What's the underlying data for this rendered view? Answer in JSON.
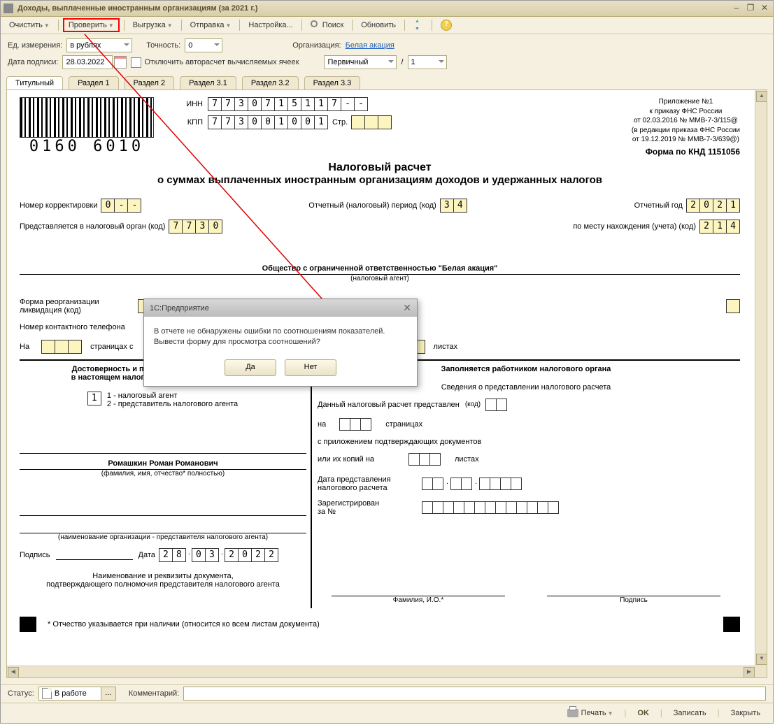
{
  "window": {
    "title": "Доходы, выплаченные иностранным организациям (за 2021 г.)"
  },
  "toolbar": {
    "clear": "Очистить",
    "check": "Проверить",
    "export": "Выгрузка",
    "send": "Отправка",
    "settings": "Настройка...",
    "search": "Поиск",
    "refresh": "Обновить"
  },
  "params": {
    "unit_label": "Ед. измерения:",
    "unit_value": "в рублях",
    "precision_label": "Точность:",
    "precision_value": "0",
    "org_label": "Организация:",
    "org_value": "Белая акация",
    "date_label": "Дата подписи:",
    "date_value": "28.03.2022",
    "autocount_label": "Отключить авторасчет вычисляемых ячеек",
    "primary_value": "Первичный",
    "slash": "/",
    "num": "1"
  },
  "tabs": [
    "Титульный",
    "Раздел 1",
    "Раздел 2",
    "Раздел 3.1",
    "Раздел 3.2",
    "Раздел 3.3"
  ],
  "form": {
    "barcode_num": "0160 6010",
    "inn_label": "ИНН",
    "inn": [
      "7",
      "7",
      "3",
      "0",
      "7",
      "1",
      "5",
      "1",
      "1",
      "7",
      "-",
      "-"
    ],
    "kpp_label": "КПП",
    "kpp": [
      "7",
      "7",
      "3",
      "0",
      "0",
      "1",
      "0",
      "0",
      "1"
    ],
    "page_label": "Стр.",
    "page": [
      "",
      "",
      ""
    ],
    "annex": [
      "Приложение №1",
      "к приказу ФНС России",
      "от 02.03.2016 № ММВ-7-3/115@",
      "(в редакции приказа ФНС России",
      "от 19.12.2019 № ММВ-7-3/639@)"
    ],
    "knd": "Форма по КНД 1151056",
    "title1": "Налоговый расчет",
    "title2": "о суммах выплаченных иностранным организациям доходов и удержанных налогов",
    "corr_label": "Номер корректировки",
    "corr": [
      "0",
      "-",
      "-"
    ],
    "period_label": "Отчетный (налоговый) период (код)",
    "period": [
      "3",
      "4"
    ],
    "year_label": "Отчетный год",
    "year": [
      "2",
      "0",
      "2",
      "1"
    ],
    "tax_org_label": "Представляется в налоговый орган (код)",
    "tax_org": [
      "7",
      "7",
      "3",
      "0"
    ],
    "place_label": "по месту нахождения (учета) (код)",
    "place": [
      "2",
      "1",
      "4"
    ],
    "org_full": "Общество с ограниченной ответственностью \"Белая акация\"",
    "agent_note": "(налоговый агент)",
    "reorg_label": "Форма реорганизации\nликвидация (код)",
    "phone_label": "Номер контактного телефона",
    "on_label": "На",
    "pages_label": "страницах с",
    "sheets_label": "листах",
    "left_h": "Достоверность и полноту сведений, указанных\nв настоящем налоговом расчете, подтверждаю:",
    "conf_flag": "1",
    "conf1": "1 - налоговый агент",
    "conf2": "2 - представитель налогового агента",
    "fio": "Ромашкин Роман Романович",
    "fio_hint": "(фамилия, имя, отчество* полностью)",
    "rep_org_hint": "(наименование организации - представителя налогового агента)",
    "sign_label": "Подпись",
    "sign_date_label": "Дата",
    "sign_date": [
      "2",
      "8",
      ".",
      "0",
      "3",
      ".",
      "2",
      "0",
      "2",
      "2"
    ],
    "doc_note": "Наименование и реквизиты документа,\nподтверждающего полномочия представителя налогового агента",
    "right_h": "Заполняется работником налогового органа",
    "right_sub": "Сведения о представлении налогового расчета",
    "r_presented": "Данный налоговый расчет представлен",
    "r_code": "(код)",
    "r_on": "на",
    "r_pages": "страницах",
    "r_attach": "с приложением подтверждающих документов",
    "r_copies": "или их копий на",
    "r_sheets": "листах",
    "r_date": "Дата представления\nналогового расчета",
    "r_reg": "Зарегистрирован\nза №",
    "r_fio": "Фамилия, И.О.*",
    "r_sign": "Подпись",
    "footnote": "* Отчество указывается при наличии (относится ко всем листам документа)"
  },
  "dialog": {
    "title": "1С:Предприятие",
    "text1": "В отчете не обнаружены ошибки по соотношениям показателей.",
    "text2": "Вывести форму для просмотра соотношений?",
    "yes": "Да",
    "no": "Нет"
  },
  "status": {
    "label": "Статус:",
    "value": "В работе",
    "comment_label": "Комментарий:"
  },
  "footer": {
    "print": "Печать",
    "ok": "OK",
    "save": "Записать",
    "close": "Закрыть"
  }
}
